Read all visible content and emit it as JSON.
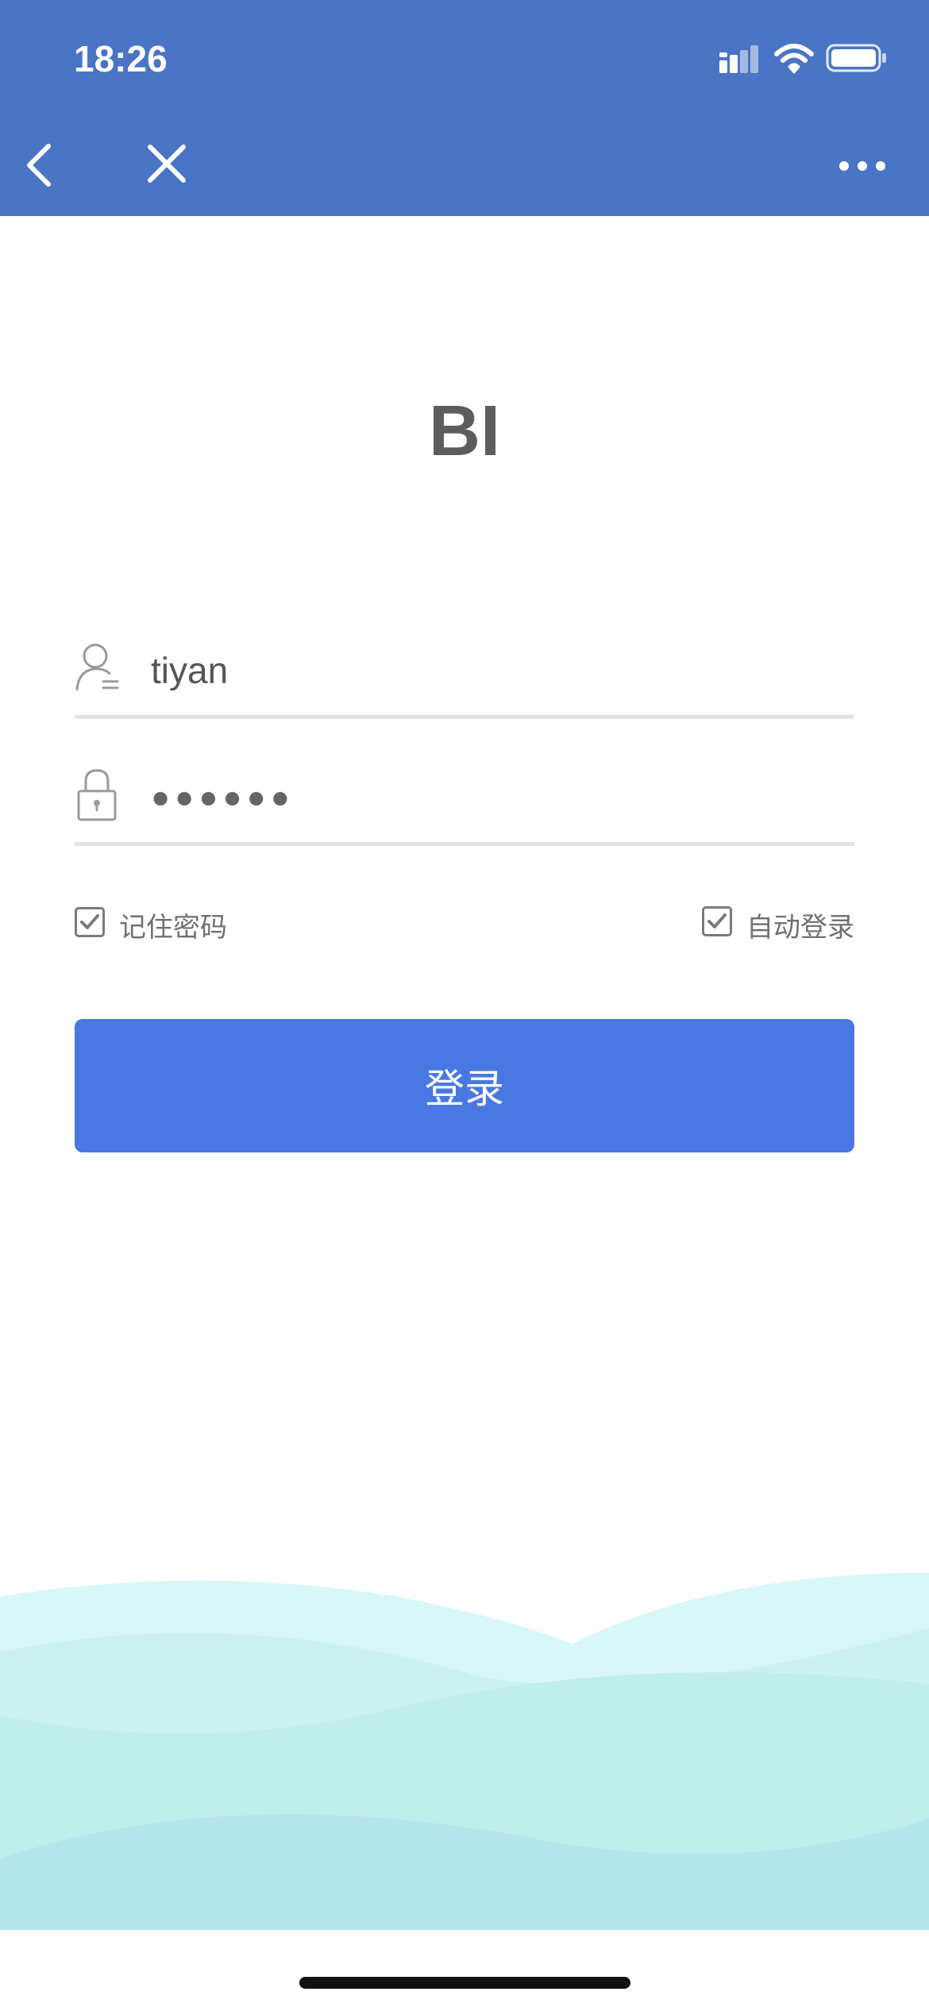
{
  "status_bar": {
    "time": "18:26"
  },
  "nav": {
    "back_icon": "chevron-left-icon",
    "close_icon": "close-icon",
    "more_icon": "more-dots-icon"
  },
  "app": {
    "title": "BI"
  },
  "form": {
    "username": {
      "icon": "user-icon",
      "value": "tiyan"
    },
    "password": {
      "icon": "lock-icon",
      "value": "●●●●●●"
    },
    "remember_password": {
      "label": "记住密码",
      "checked": true
    },
    "auto_login": {
      "label": "自动登录",
      "checked": true
    },
    "login_button": "登录"
  },
  "colors": {
    "header": "#4a74c4",
    "button": "#4a78e2",
    "title": "#5d5d5d",
    "wave_light": "#d7f6f8",
    "wave_mid": "#c5efec",
    "wave_dark": "#b5e5ea"
  }
}
